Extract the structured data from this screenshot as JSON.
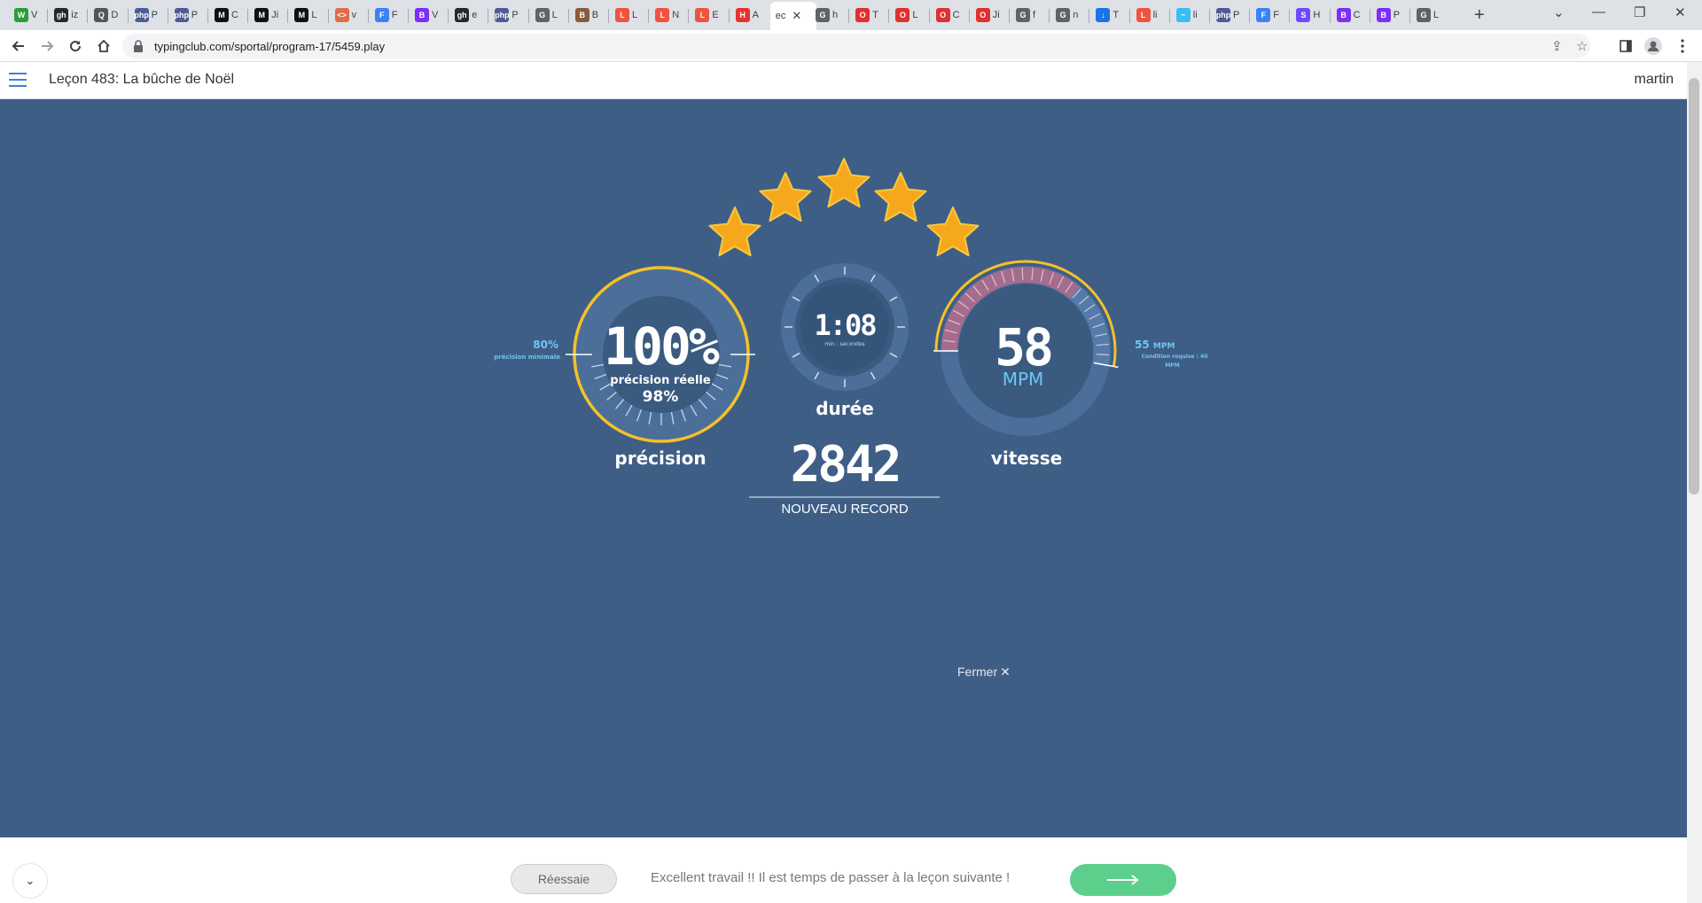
{
  "browser": {
    "tabs": [
      {
        "letter": "V",
        "fav": "W",
        "color": "#2a9d3a",
        "text": "#2a9d3a"
      },
      {
        "letter": "iz",
        "fav": "gh",
        "color": "#24292e"
      },
      {
        "letter": "D",
        "fav": "Q",
        "color": "#555555"
      },
      {
        "letter": "P",
        "fav": "php",
        "color": "#4f5b93"
      },
      {
        "letter": "P",
        "fav": "php",
        "color": "#4f5b93"
      },
      {
        "letter": "C",
        "fav": "M",
        "color": "#111111"
      },
      {
        "letter": "Ji",
        "fav": "M",
        "color": "#111111"
      },
      {
        "letter": "L",
        "fav": "M",
        "color": "#111111"
      },
      {
        "letter": "v",
        "fav": "<>",
        "color": "#e06c4a"
      },
      {
        "letter": "F",
        "fav": "F",
        "color": "#3b82f6"
      },
      {
        "letter": "V",
        "fav": "B",
        "color": "#7b2ff7"
      },
      {
        "letter": "e",
        "fav": "gh",
        "color": "#24292e"
      },
      {
        "letter": "P",
        "fav": "php",
        "color": "#4f5b93"
      },
      {
        "letter": "L",
        "fav": "G",
        "color": "#5f6368"
      },
      {
        "letter": "B",
        "fav": "B",
        "color": "#8a5a3c"
      },
      {
        "letter": "L",
        "fav": "L",
        "color": "#f05340"
      },
      {
        "letter": "N",
        "fav": "L",
        "color": "#f05340"
      },
      {
        "letter": "E",
        "fav": "L",
        "color": "#f05340"
      },
      {
        "letter": "A",
        "fav": "H",
        "color": "#e8322b"
      },
      {
        "letter": "ec",
        "fav": "",
        "color": "#ffffff",
        "active": true
      },
      {
        "letter": "h",
        "fav": "G",
        "color": "#5f6368"
      },
      {
        "letter": "T",
        "fav": "O",
        "color": "#e03030"
      },
      {
        "letter": "L",
        "fav": "O",
        "color": "#e03030"
      },
      {
        "letter": "C",
        "fav": "O",
        "color": "#e03030"
      },
      {
        "letter": "Ji",
        "fav": "O",
        "color": "#e03030"
      },
      {
        "letter": "f",
        "fav": "G",
        "color": "#5f6368"
      },
      {
        "letter": "n",
        "fav": "G",
        "color": "#5f6368"
      },
      {
        "letter": "T",
        "fav": "↓",
        "color": "#1a73e8"
      },
      {
        "letter": "li",
        "fav": "L",
        "color": "#f05340"
      },
      {
        "letter": "li",
        "fav": "~",
        "color": "#38bdf8"
      },
      {
        "letter": "P",
        "fav": "php",
        "color": "#4f5b93"
      },
      {
        "letter": "F",
        "fav": "F",
        "color": "#3b82f6"
      },
      {
        "letter": "H",
        "fav": "S",
        "color": "#6d4aff"
      },
      {
        "letter": "C",
        "fav": "B",
        "color": "#7b2ff7"
      },
      {
        "letter": "P",
        "fav": "B",
        "color": "#7b2ff7"
      },
      {
        "letter": "L",
        "fav": "G",
        "color": "#5f6368"
      }
    ],
    "active_tab_close": "✕",
    "new_tab": "+",
    "window_controls": {
      "dropdown": "⌄",
      "minimize": "—",
      "restore": "❐",
      "close": "✕"
    },
    "url": "typingclub.com/sportal/program-17/5459.play"
  },
  "header": {
    "lesson_title": "Leçon 483: La bûche de Noël",
    "user": "martin"
  },
  "results": {
    "stars": 5,
    "accuracy": {
      "value": "100%",
      "real_label": "précision réelle",
      "real_value": "98%",
      "label": "précision",
      "min_value": "80%",
      "min_label": "précision minimale",
      "fraction": 1.0
    },
    "duration": {
      "value": "1:08",
      "unit": "min : secondes",
      "label": "durée"
    },
    "speed": {
      "value": "58",
      "unit": "MPM",
      "label": "vitesse",
      "target_value": "55",
      "target_unit": "MPM",
      "requirement": "Condition requise : 40",
      "requirement_unit": "MPM",
      "fraction": 1.0
    },
    "score": {
      "value": "2842",
      "label": "NOUVEAU RECORD"
    },
    "close_label": "Fermer",
    "close_icon": "✕"
  },
  "footer": {
    "collapse_icon": "⌄",
    "retry_label": "Réessaie",
    "message": "Excellent travail !! Il est temps de passer à la leçon suivante !",
    "next_icon": "arrow-right"
  },
  "colors": {
    "background": "#3e5e86",
    "gauge_ring": "#4b6f99",
    "gauge_inner": "#3a5a80",
    "accent_yellow": "#f5c12a",
    "speed_arc": "#b06b8c",
    "cyan": "#6ec6ef",
    "next_button": "#5ccf8d"
  }
}
